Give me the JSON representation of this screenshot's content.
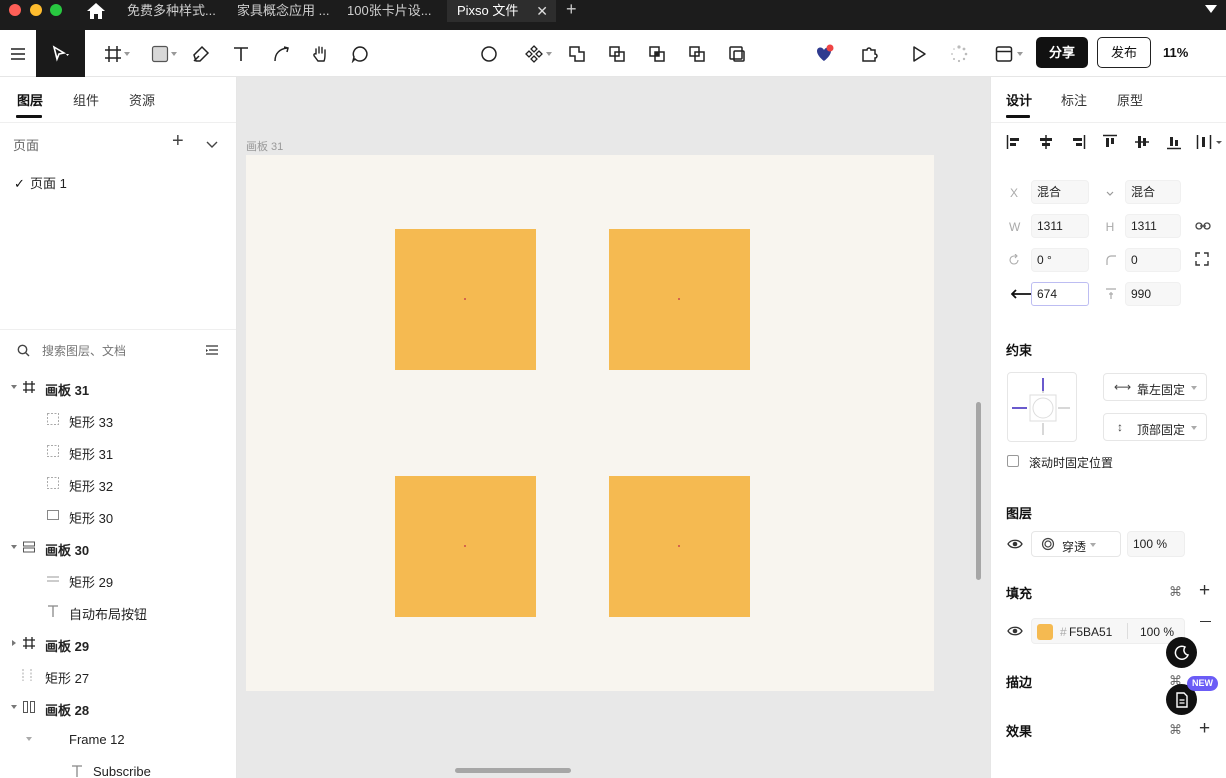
{
  "window": {
    "tabs": [
      {
        "label": "免费多种样式..."
      },
      {
        "label": "家具概念应用 ..."
      },
      {
        "label": "100张卡片设..."
      },
      {
        "label": "Pixso 文件",
        "active": true
      }
    ]
  },
  "toolbar": {
    "share_label": "分享",
    "publish_label": "发布",
    "zoom": "11%",
    "icons": [
      "menu-icon",
      "move-tool-icon",
      "frame-tool-icon",
      "rectangle-tool-icon",
      "pen-tool-icon",
      "text-tool-icon",
      "pencil-tool-icon",
      "hand-tool-icon",
      "comment-tool-icon",
      "circle-icon",
      "component-icon",
      "union-icon",
      "subtract-icon",
      "intersect-icon",
      "exclude-icon",
      "flatten-icon",
      "ai-assistant-icon",
      "plugin-icon",
      "play-icon",
      "loading-icon",
      "layout-icon"
    ],
    "colors": {
      "active_tool_bg": "#1a1a1a",
      "notification_dot": "#ef4444"
    }
  },
  "left_panel": {
    "tabs": [
      "图层",
      "组件",
      "资源"
    ],
    "pages_title": "页面",
    "pages": [
      {
        "label": "页面 1",
        "selected": true
      }
    ],
    "search_placeholder": "搜索图层、文档",
    "layers": [
      {
        "label": "画板 31",
        "level": 0,
        "bold": true,
        "icon": "frame-icon",
        "expanded": true
      },
      {
        "label": "矩形 33",
        "level": 1,
        "bold": false,
        "icon": "rectangle-dashed-icon"
      },
      {
        "label": "矩形 31",
        "level": 1,
        "bold": false,
        "icon": "rectangle-dashed-icon"
      },
      {
        "label": "矩形 32",
        "level": 1,
        "bold": false,
        "icon": "rectangle-dashed-icon"
      },
      {
        "label": "矩形 30",
        "level": 1,
        "bold": false,
        "icon": "rectangle-icon"
      },
      {
        "label": "画板 30",
        "level": 0,
        "bold": true,
        "icon": "auto-layout-icon",
        "expanded": true
      },
      {
        "label": "矩形 29",
        "level": 1,
        "bold": false,
        "icon": "line-icon"
      },
      {
        "label": "自动布局按钮",
        "level": 1,
        "bold": false,
        "icon": "text-icon"
      },
      {
        "label": "画板 29",
        "level": 0,
        "bold": true,
        "icon": "frame-icon",
        "expanded": false
      },
      {
        "label": "矩形 27",
        "level": 0,
        "bold": false,
        "icon": "rectangle-dashed-icon"
      },
      {
        "label": "画板 28",
        "level": 0,
        "bold": true,
        "icon": "auto-layout-horizontal-icon",
        "expanded": true
      },
      {
        "label": "Frame 12",
        "level": 1,
        "bold": false,
        "icon": "frame-small-icon",
        "expanded": true
      },
      {
        "label": "Subscribe",
        "level": 2,
        "bold": false,
        "icon": "text-icon"
      }
    ]
  },
  "canvas": {
    "frame_label": "画板 31",
    "colors": {
      "artboard_bg": "#f8f5ef",
      "card_fill": "#F5BA51"
    }
  },
  "right_panel": {
    "tabs": [
      "设计",
      "标注",
      "原型"
    ],
    "props": {
      "x_label": "X",
      "x_value": "混合",
      "y_value": "混合",
      "w_label": "W",
      "w_value": "1311",
      "h_label": "H",
      "h_value": "1311",
      "rotation_value": "0 °",
      "radius_value": "0",
      "spacing_value": "674",
      "padding_value": "990"
    },
    "constraints": {
      "title": "约束",
      "horizontal": "靠左固定",
      "vertical": "顶部固定",
      "fix_on_scroll": "滚动时固定位置"
    },
    "layer": {
      "title": "图层",
      "blend": "穿透",
      "opacity": "100 %"
    },
    "fill": {
      "title": "填充",
      "hex_prefix": "#",
      "hex": "F5BA51",
      "opacity": "100 %"
    },
    "stroke": {
      "title": "描边"
    },
    "effects": {
      "title": "效果"
    },
    "new_badge": "NEW",
    "colors": {
      "constraint_accent": "#6a5acd",
      "badge_bg": "#6b5cf6"
    }
  }
}
